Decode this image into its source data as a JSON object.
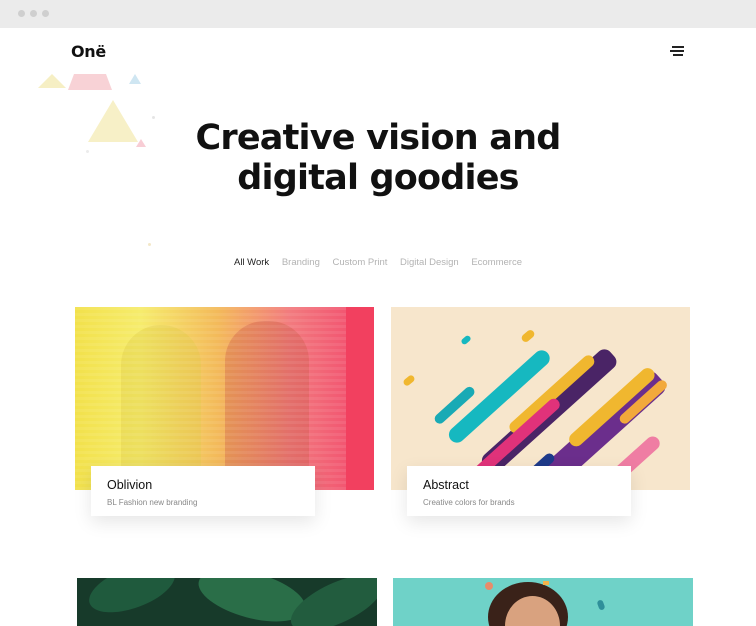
{
  "browser": {
    "window_controls": [
      "close",
      "minimize",
      "maximize"
    ]
  },
  "header": {
    "logo": "Onë",
    "menu_icon": "hamburger-icon"
  },
  "hero": {
    "title_line1": "Creative vision and",
    "title_line2": "digital goodies"
  },
  "filters": [
    {
      "label": "All Work",
      "active": true
    },
    {
      "label": "Branding",
      "active": false
    },
    {
      "label": "Custom Print",
      "active": false
    },
    {
      "label": "Digital Design",
      "active": false
    },
    {
      "label": "Ecommerce",
      "active": false
    }
  ],
  "portfolio": [
    {
      "title": "Oblivion",
      "subtitle": "BL Fashion new branding"
    },
    {
      "title": "Abstract",
      "subtitle": "Creative colors for brands"
    }
  ],
  "colors": {
    "accent_yellow": "#f3e46a",
    "accent_pink": "#f06a86",
    "abstract_bg": "#f7e6cc"
  }
}
